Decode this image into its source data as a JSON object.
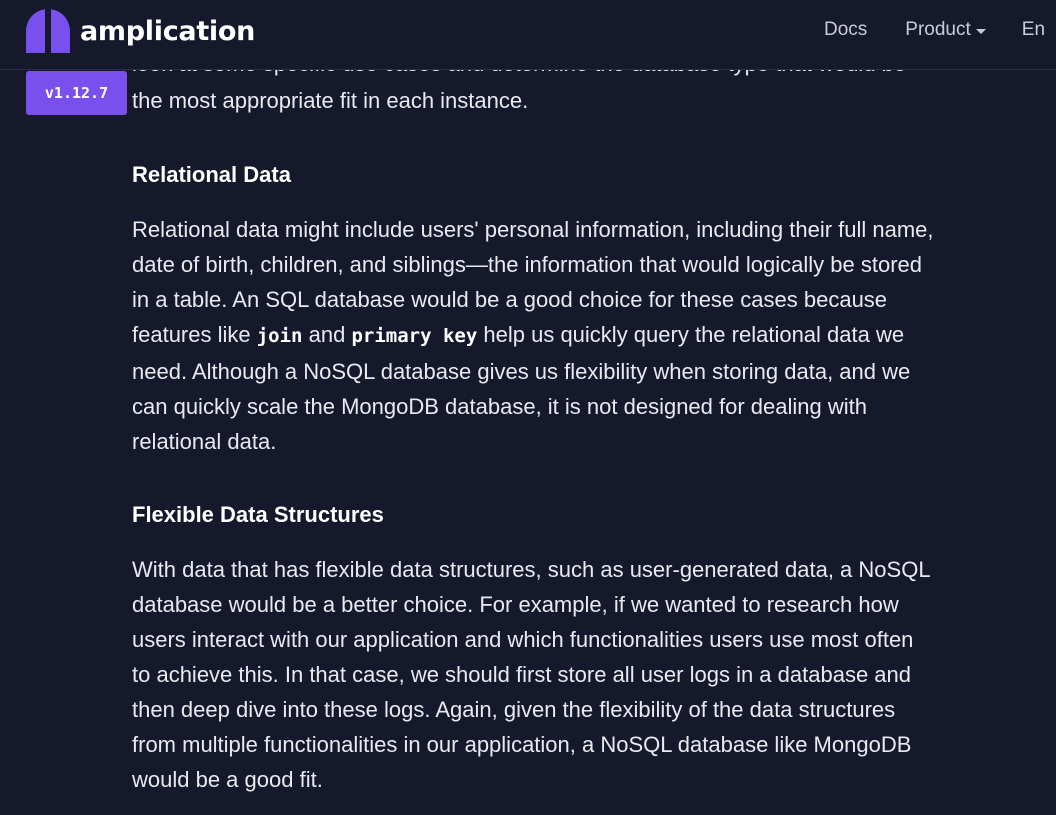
{
  "brand": {
    "name": "amplication",
    "logo_color": "#7950ed"
  },
  "nav": {
    "docs": "Docs",
    "product": "Product",
    "enterprise_partial": "En"
  },
  "version": "v1.12.7",
  "article": {
    "intro_cut_line": "look at some specific use cases and determine the database type that would be",
    "intro_last_line": "the most appropriate fit in each instance.",
    "sections": [
      {
        "heading": "Relational Data",
        "lines": [
          "Relational data might include users' personal information, including their full name,",
          "date of birth, children, and siblings—the information that would logically be stored",
          "in a table. An SQL database would be a good choice for these cases because",
          {
            "pre": "features like ",
            "code1": "join",
            "mid": " and ",
            "code2": "primary key",
            "post": " help us quickly query the relational data we"
          },
          "need. Although a NoSQL database gives us flexibility when storing data, and we",
          "can quickly scale the MongoDB database, it is not designed for dealing with",
          "relational data."
        ]
      },
      {
        "heading": "Flexible Data Structures",
        "lines": [
          "With data that has flexible data structures, such as user-generated data, a NoSQL",
          "database would be a better choice. For example, if we wanted to research how",
          "users interact with our application and which functionalities users use most often",
          "to achieve this. In that case, we should first store all user logs in a database and",
          "then deep dive into these logs. Again, given the flexibility of the data structures",
          "from multiple functionalities in our application, a NoSQL database like MongoDB",
          "would be a good fit."
        ]
      }
    ]
  }
}
